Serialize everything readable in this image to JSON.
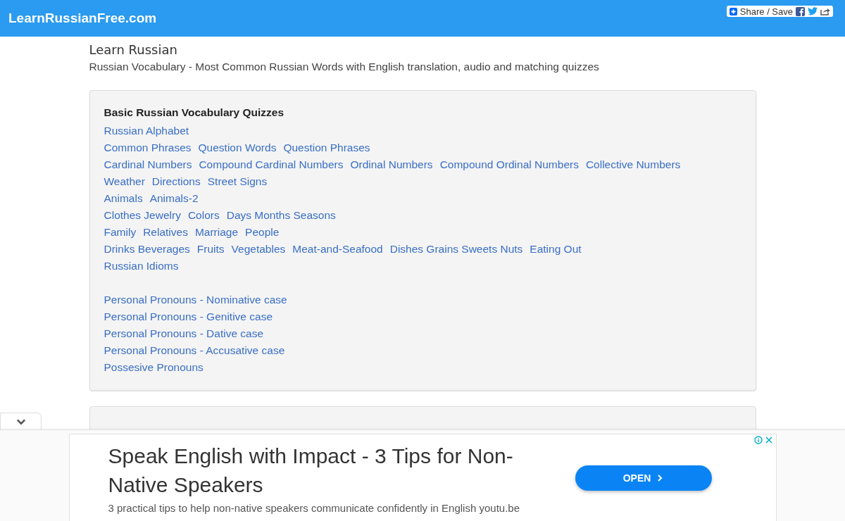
{
  "header": {
    "logo": "LearnRussianFree.com",
    "share": {
      "label": "Share / Save"
    }
  },
  "page": {
    "title": "Learn Russian",
    "subtitle": "Russian Vocabulary - Most Common Russian Words with English translation, audio and matching quizzes"
  },
  "cards": [
    {
      "title": "Basic Russian Vocabulary Quizzes",
      "groups": [
        [
          [
            "Russian Alphabet"
          ],
          [
            "Common Phrases",
            "Question Words",
            "Question Phrases"
          ],
          [
            "Cardinal Numbers",
            "Compound Cardinal Numbers",
            "Ordinal Numbers",
            "Compound Ordinal Numbers",
            "Collective Numbers"
          ],
          [
            "Weather",
            "Directions",
            "Street Signs"
          ],
          [
            "Animals",
            "Animals-2"
          ],
          [
            "Clothes Jewelry",
            "Colors",
            "Days Months Seasons"
          ],
          [
            "Family",
            "Relatives",
            "Marriage",
            "People"
          ],
          [
            "Drinks Beverages",
            "Fruits",
            "Vegetables",
            "Meat-and-Seafood",
            "Dishes Grains Sweets Nuts",
            "Eating Out"
          ],
          [
            "Russian Idioms"
          ]
        ],
        [
          [
            "Personal Pronouns - Nominative case"
          ],
          [
            "Personal Pronouns - Genitive case"
          ],
          [
            "Personal Pronouns - Dative case"
          ],
          [
            "Personal Pronouns - Accusative case"
          ],
          [
            "Possesive Pronouns"
          ]
        ]
      ]
    }
  ],
  "ad": {
    "headline": "Speak English with Impact - 3 Tips for Non-Native Speakers",
    "description": "3 practical tips to help non-native speakers communicate confidently in English youtu.be",
    "button": "OPEN"
  }
}
